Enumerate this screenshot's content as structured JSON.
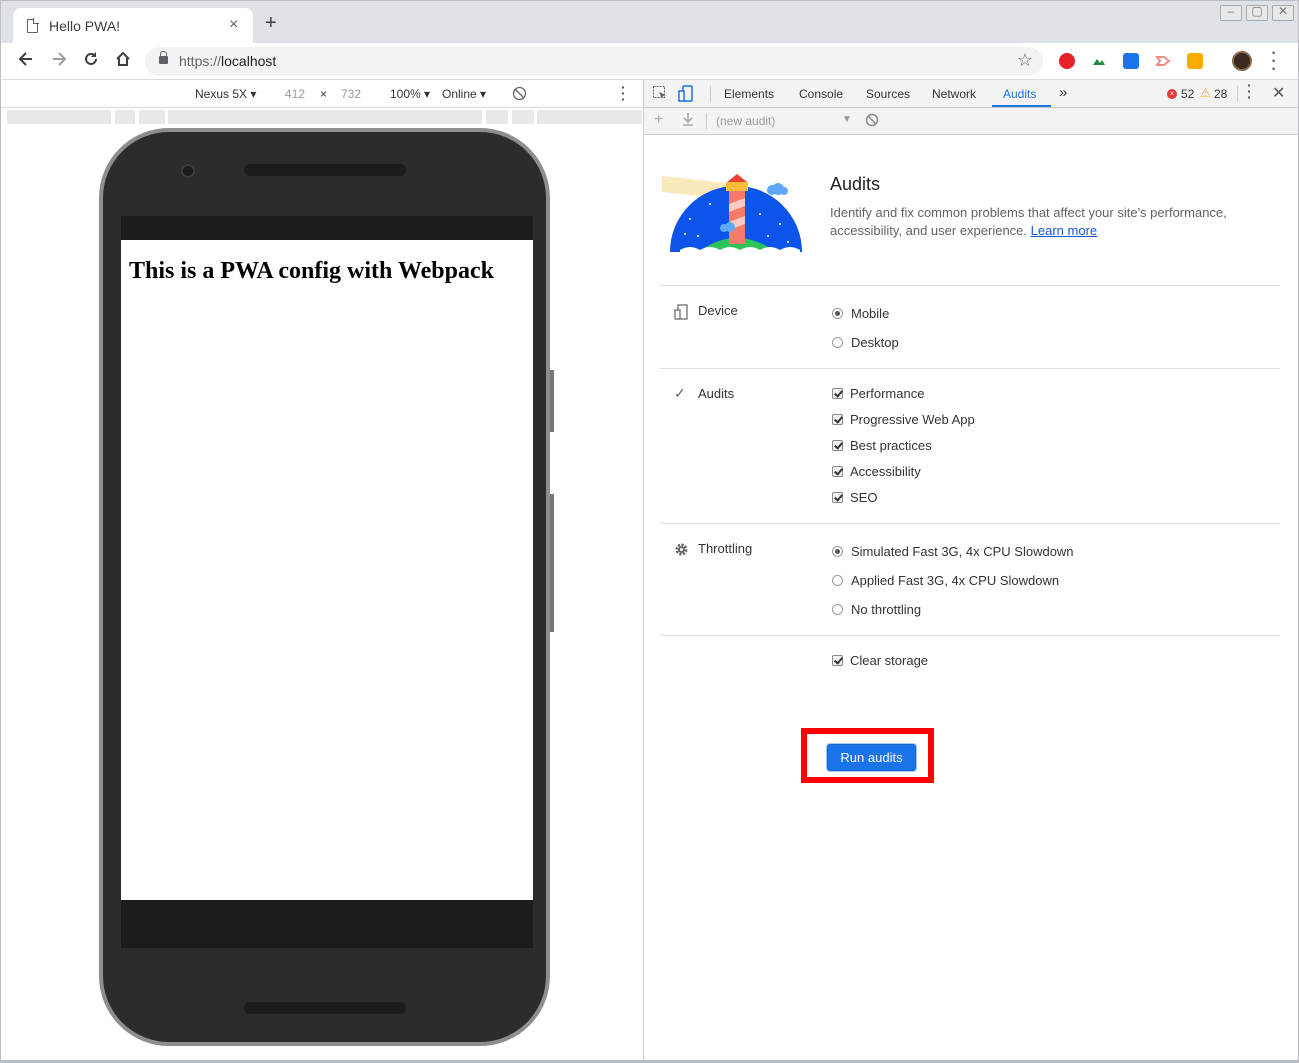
{
  "browser": {
    "tab_title": "Hello PWA!",
    "tab_close": "×",
    "new_tab": "+",
    "window_buttons": [
      "–",
      "▢",
      "✕"
    ],
    "url_scheme": "https://",
    "url_host": "localhost",
    "extension_colors": [
      "#e8202a",
      "#1e8e3e",
      "#1a73e8",
      "#f28b82",
      "#f9ab00"
    ]
  },
  "device_toolbar": {
    "device": "Nexus 5X",
    "width": "412",
    "times": "×",
    "height": "732",
    "zoom": "100%",
    "network": "Online"
  },
  "page": {
    "heading": "This is a PWA config with Webpack"
  },
  "devtools": {
    "tabs": [
      "Elements",
      "Console",
      "Sources",
      "Network",
      "Audits"
    ],
    "active_tab": "Audits",
    "more_tabs": "»",
    "error_count": "52",
    "warning_count": "28",
    "new_audit": "(new audit)",
    "accent_color": "#1a73e8"
  },
  "audits": {
    "title": "Audits",
    "description": "Identify and fix common problems that affect your site's performance, accessibility, and user experience.",
    "learn_more": "Learn more",
    "device_label": "Device",
    "device_options": [
      "Mobile",
      "Desktop"
    ],
    "device_selected": "Mobile",
    "audits_label": "Audits",
    "categories": [
      "Performance",
      "Progressive Web App",
      "Best practices",
      "Accessibility",
      "SEO"
    ],
    "throttling_label": "Throttling",
    "throttling_options": [
      "Simulated Fast 3G, 4x CPU Slowdown",
      "Applied Fast 3G, 4x CPU Slowdown",
      "No throttling"
    ],
    "throttling_selected": "Simulated Fast 3G, 4x CPU Slowdown",
    "clear_storage": "Clear storage",
    "run_button": "Run audits",
    "highlight_color": "#ff0000"
  }
}
